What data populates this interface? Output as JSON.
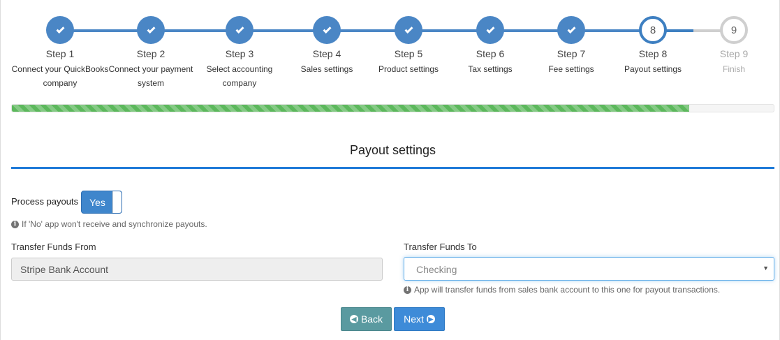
{
  "wizard": {
    "steps": [
      {
        "number": "1",
        "title": "Step 1",
        "desc_lines": [
          "Connect your QuickBooks",
          "company"
        ],
        "state": "done"
      },
      {
        "number": "2",
        "title": "Step 2",
        "desc_lines": [
          "Connect your payment",
          "system"
        ],
        "state": "done"
      },
      {
        "number": "3",
        "title": "Step 3",
        "desc_lines": [
          "Select accounting",
          "company"
        ],
        "state": "done"
      },
      {
        "number": "4",
        "title": "Step 4",
        "desc_lines": [
          "Sales settings"
        ],
        "state": "done"
      },
      {
        "number": "5",
        "title": "Step 5",
        "desc_lines": [
          "Product settings"
        ],
        "state": "done"
      },
      {
        "number": "6",
        "title": "Step 6",
        "desc_lines": [
          "Tax settings"
        ],
        "state": "done"
      },
      {
        "number": "7",
        "title": "Step 7",
        "desc_lines": [
          "Fee settings"
        ],
        "state": "done"
      },
      {
        "number": "8",
        "title": "Step 8",
        "desc_lines": [
          "Payout settings"
        ],
        "state": "current"
      },
      {
        "number": "9",
        "title": "Step 9",
        "desc_lines": [
          "Finish"
        ],
        "state": "todo"
      }
    ],
    "progress_fraction": 0.889
  },
  "section": {
    "title": "Payout settings"
  },
  "process_payouts": {
    "label": "Process payouts",
    "toggle_label": "Yes",
    "toggle_on": true,
    "hint": "If 'No' app won't receive and synchronize payouts."
  },
  "transfer_from": {
    "label": "Transfer Funds From",
    "value": "Stripe Bank Account"
  },
  "transfer_to": {
    "label": "Transfer Funds To",
    "value": "Checking",
    "hint": "App will transfer funds from sales bank account to this one for payout transactions."
  },
  "buttons": {
    "back_label": "Back",
    "next_label": "Next"
  },
  "colors": {
    "done": "#4a86c5",
    "current": "#3d7fc1",
    "todo": "#cfcfcf",
    "progress": "#5cb85c",
    "accent": "#1f7ad8"
  }
}
